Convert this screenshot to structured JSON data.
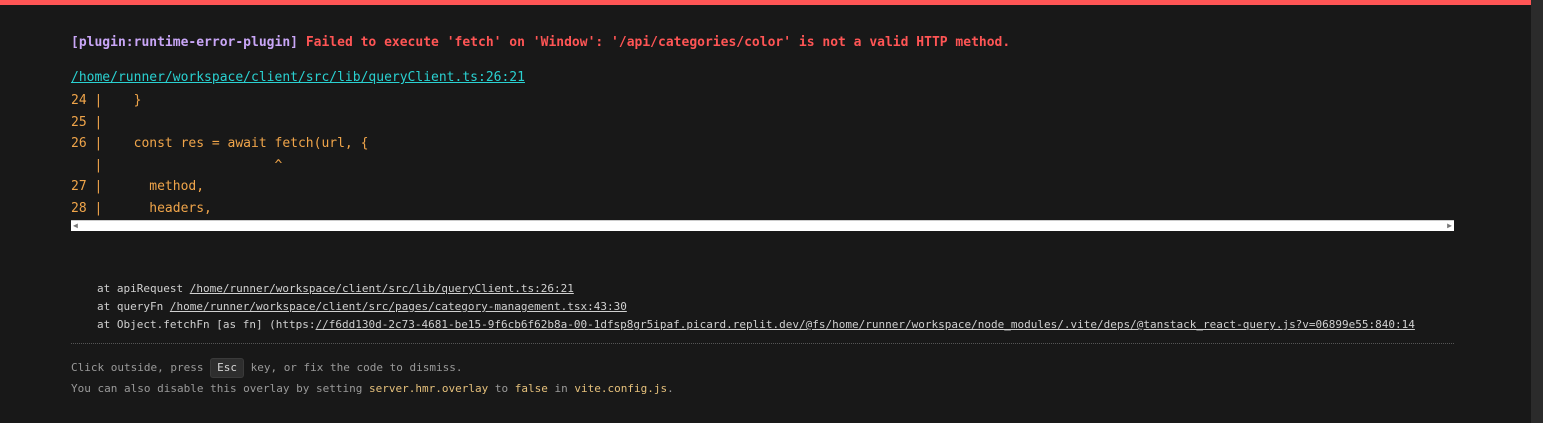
{
  "error": {
    "plugin": "[plugin:runtime-error-plugin]",
    "message": "Failed to execute 'fetch' on 'Window': '/api/categories/color' is not a valid HTTP method."
  },
  "file_link": "/home/runner/workspace/client/src/lib/queryClient.ts:26:21",
  "code_frame": [
    "24 |    }",
    "25 |",
    "26 |    const res = await fetch(url, {",
    "   |                      ^",
    "27 |      method,",
    "28 |      headers,"
  ],
  "stack": [
    {
      "prefix": "at apiRequest ",
      "path": "/home/runner/workspace/client/src/lib/queryClient.ts:26:21",
      "suffix": ""
    },
    {
      "prefix": "at queryFn ",
      "path": "/home/runner/workspace/client/src/pages/category-management.tsx:43:30",
      "suffix": ""
    },
    {
      "prefix": "at Object.fetchFn [as fn] (https:",
      "path": "//f6dd130d-2c73-4681-be15-9f6cb6f62b8a-00-1dfsp8gr5ipaf.picard.replit.dev/@fs/home/runner/workspace/node_modules/.vite/deps/@tanstack_react-query.js?v=06899e55:840:14",
      "suffix": ""
    }
  ],
  "tip": {
    "line1_prefix": "Click outside, press ",
    "key": "Esc",
    "line1_suffix": " key, or fix the code to dismiss.",
    "line2_a": "You can also disable this overlay by setting ",
    "line2_config": "server.hmr.overlay",
    "line2_b": " to ",
    "line2_false": "false",
    "line2_c": " in ",
    "line2_file": "vite.config.js",
    "line2_d": "."
  },
  "colors": {
    "background": "#181818",
    "accent_bar": "#ff5555",
    "plugin": "#c9a6f7",
    "message": "#ff5555",
    "link": "#2ad1d1",
    "code": "#f0a54a",
    "highlight": "#e5c07b"
  },
  "icons": {
    "scroll_left": "scroll-left-arrow-icon",
    "scroll_right": "scroll-right-arrow-icon"
  }
}
